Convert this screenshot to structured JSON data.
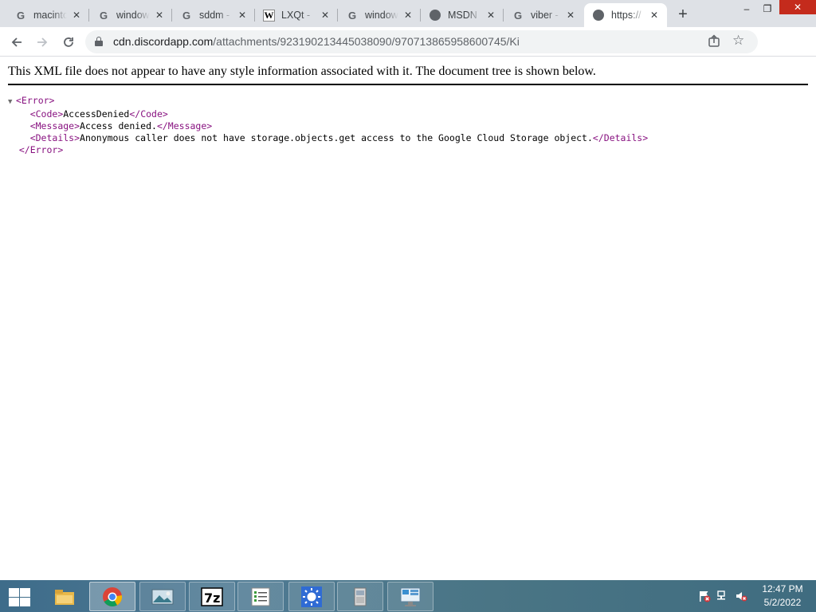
{
  "browser": {
    "tabs": [
      {
        "label": "macintosh",
        "favicon": "google-icon",
        "active": false
      },
      {
        "label": "windows",
        "favicon": "google-icon",
        "active": false
      },
      {
        "label": "sddm -",
        "favicon": "google-icon",
        "active": false
      },
      {
        "label": "LXQt -",
        "favicon": "wikipedia-icon",
        "active": false
      },
      {
        "label": "windows",
        "favicon": "google-icon",
        "active": false
      },
      {
        "label": "MSDN",
        "favicon": "globe-icon",
        "active": false
      },
      {
        "label": "viber -",
        "favicon": "google-icon",
        "active": false
      },
      {
        "label": "https://",
        "favicon": "globe-icon",
        "active": true
      }
    ],
    "new_tab_label": "+",
    "window_controls": {
      "minimize": "–",
      "maximize": "❐",
      "close": "✕"
    },
    "url": {
      "host": "cdn.discordapp.com",
      "path": "/attachments/923190213445038090/970713865958600745/Ki"
    }
  },
  "page": {
    "notice": "This XML file does not appear to have any style information associated with it. The document tree is shown below.",
    "xml": {
      "root_open": "<Error>",
      "code_open": "<Code>",
      "code_value": "AccessDenied",
      "code_close": "</Code>",
      "message_open": "<Message>",
      "message_value": "Access denied.",
      "message_close": "</Message>",
      "details_open": "<Details>",
      "details_value": "Anonymous caller does not have storage.objects.get access to the Google Cloud Storage object.",
      "details_close": "</Details>",
      "root_close": "</Error>"
    }
  },
  "taskbar": {
    "apps": [
      "file-explorer-icon",
      "chrome-icon",
      "photo-viewer-icon",
      "7zip-icon",
      "notepad-list-icon",
      "sun-app-icon",
      "archive-app-icon",
      "control-panel-icon"
    ],
    "clock": {
      "time": "12:47 PM",
      "date": "5/2/2022"
    }
  }
}
